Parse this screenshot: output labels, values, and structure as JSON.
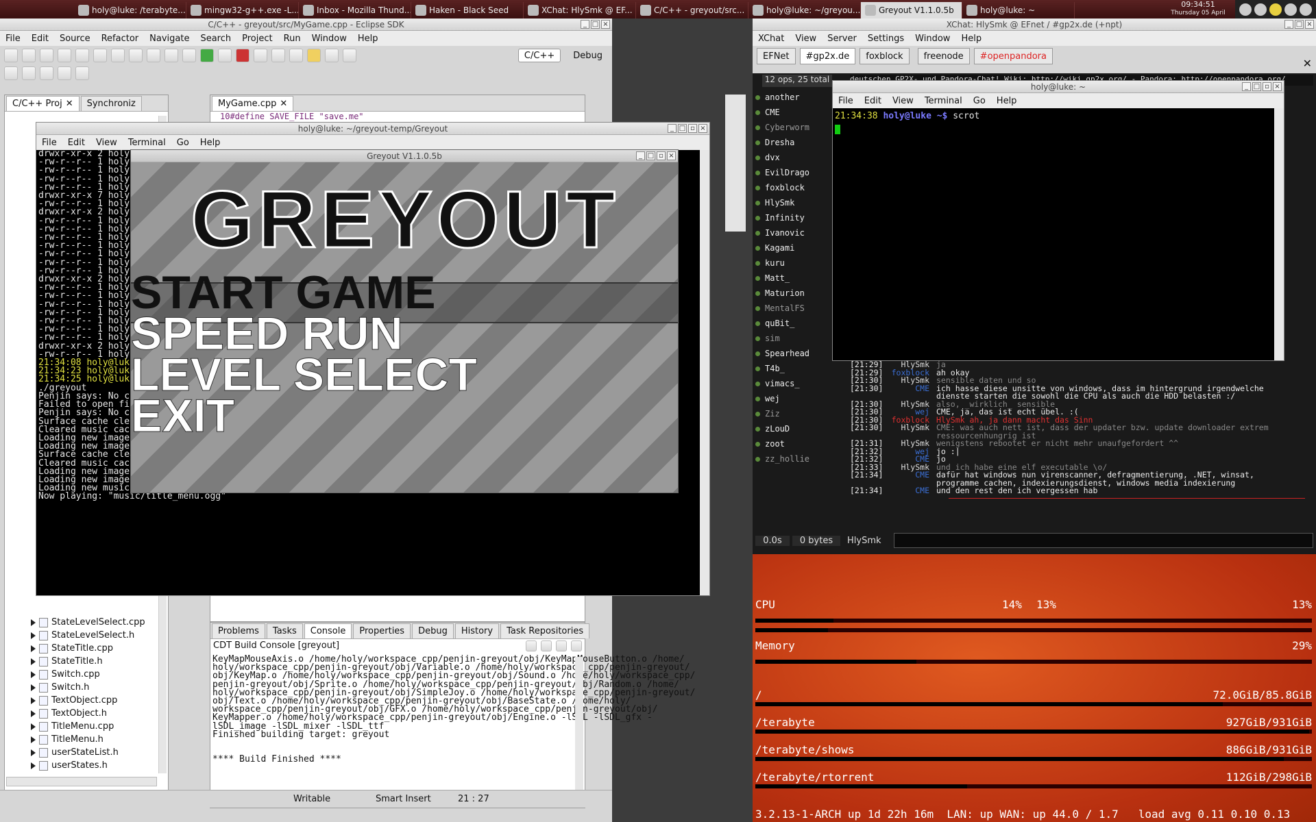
{
  "taskbar": {
    "tasks": [
      {
        "label": "holy@luke: /terabyte...",
        "icon": "terminal-icon"
      },
      {
        "label": "mingw32-g++.exe -L...",
        "icon": "firefox-icon"
      },
      {
        "label": "Inbox - Mozilla Thund...",
        "icon": "thunderbird-icon"
      },
      {
        "label": "Haken - Black Seed",
        "icon": "media-icon"
      },
      {
        "label": "XChat: HlySmk @ EF...",
        "icon": "xchat-icon"
      },
      {
        "label": "C/C++ - greyout/src...",
        "icon": "eclipse-icon"
      },
      {
        "label": "holy@luke: ~/greyou...",
        "icon": "terminal-icon"
      },
      {
        "label": "Greyout V1.1.0.5b",
        "icon": "game-icon"
      },
      {
        "label": "holy@luke: ~",
        "icon": "terminal-icon"
      }
    ],
    "clock_time": "09:34:51",
    "clock_date": "Thursday 05 April"
  },
  "eclipse": {
    "title": "C/C++ - greyout/src/MyGame.cpp - Eclipse SDK",
    "menu": [
      "File",
      "Edit",
      "Source",
      "Refactor",
      "Navigate",
      "Search",
      "Project",
      "Run",
      "Window",
      "Help"
    ],
    "perspectives": [
      "C/C++",
      "Debug"
    ],
    "left_tabs": [
      "C/C++ Proj",
      "Synchroniz"
    ],
    "editor_tab": "MyGame.cpp",
    "editor_line": "10#define SAVE_FILE \"save.me\"",
    "tree": [
      "StateLevelSelect.cpp",
      "StateLevelSelect.h",
      "StateTitle.cpp",
      "StateTitle.h",
      "Switch.cpp",
      "Switch.h",
      "TextObject.cpp",
      "TextObject.h",
      "TitleMenu.cpp",
      "TitleMenu.h",
      "userStateList.h",
      "userStates.h"
    ],
    "bottom_tabs": [
      "Problems",
      "Tasks",
      "Console",
      "Properties",
      "Debug",
      "History",
      "Task Repositories"
    ],
    "console_title": "CDT Build Console [greyout]",
    "console_lines": [
      "KeyMapMouseAxis.o /home/holy/workspace_cpp/penjin-greyout/obj/KeyMapMouseButton.o /home/",
      "holy/workspace_cpp/penjin-greyout/obj/Variable.o /home/holy/workspace_cpp/penjin-greyout/",
      "obj/KeyMap.o /home/holy/workspace_cpp/penjin-greyout/obj/Sound.o /home/holy/workspace_cpp/",
      "penjin-greyout/obj/Sprite.o /home/holy/workspace_cpp/penjin-greyout/obj/Random.o /home/",
      "holy/workspace_cpp/penjin-greyout/obj/SimpleJoy.o /home/holy/workspace_cpp/penjin-greyout/",
      "obj/Text.o /home/holy/workspace_cpp/penjin-greyout/obj/BaseState.o /home/holy/",
      "workspace_cpp/penjin-greyout/obj/GFX.o /home/holy/workspace_cpp/penjin-greyout/obj/",
      "KeyMapper.o /home/holy/workspace_cpp/penjin-greyout/obj/Engine.o -lSDL -lSDL_gfx -",
      "lSDL_image -lSDL_mixer -lSDL_ttf",
      "Finished building target: greyout",
      "",
      "",
      "**** Build Finished ****"
    ],
    "status": [
      "Writable",
      "Smart Insert",
      "21 : 27"
    ]
  },
  "term1": {
    "title": "holy@luke: ~/greyout-temp/Greyout",
    "menu": [
      "File",
      "Edit",
      "View",
      "Terminal",
      "Go",
      "Help"
    ],
    "lines": [
      "drwxr-xr-x 2 holy",
      "-rw-r--r-- 1 holy",
      "-rw-r--r-- 1 holy",
      "-rw-r--r-- 1 holy",
      "-rw-r--r-- 1 holy",
      "drwxr-xr-x 7 holy",
      "-rw-r--r-- 1 holy",
      "drwxr-xr-x 2 holy",
      "-rw-r--r-- 1 holy",
      "-rw-r--r-- 1 holy",
      "-rw-r--r-- 1 holy",
      "-rw-r--r-- 1 holy",
      "-rw-r--r-- 1 holy",
      "-rw-r--r-- 1 holy",
      "-rw-r--r-- 1 holy",
      "drwxr-xr-x 2 holy",
      "-rw-r--r-- 1 holy",
      "-rw-r--r-- 1 holy",
      "-rw-r--r-- 1 holy",
      "-rw-r--r-- 1 holy",
      "-rw-r--r-- 1 holy",
      "-rw-r--r-- 1 holy",
      "-rw-r--r-- 1 holy",
      "drwxr-xr-x 2 holy",
      "-rw-r--r-- 1 holy"
    ],
    "prompts": [
      "21:34:08 holy@luk",
      "21:34:23 holy@luk",
      "21:34:25 holy@luk"
    ],
    "tail": [
      "./greyout",
      "Penjin says: No c",
      "Failed to open fi",
      "Penjin says: No c",
      "Surface cache cle",
      "Cleared music cache - deleted 0 music tracks (0 still playing).",
      "Loading new image to cache \"images/general/Pandora_logo-unofficial.png\"",
      "Loading new image to cache \"images/general/penjinsigok5.png\"",
      "Surface cache cleared - deleted 2 images!",
      "Cleared music cache - deleted 0 music tracks (0 still playing).",
      "Loading new image to cache \"images/menu/title_800_480.png\"",
      "Loading new image to cache \"images/menu/title_marker_800_480.png\"",
      "Loading new music track to cache \"music/title_menu.ogg\"",
      "Now playing: \"music/title_menu.ogg\""
    ]
  },
  "game": {
    "title": "Greyout V1.1.0.5b",
    "logo": "GREYOUT",
    "items": [
      "START GAME",
      "SPEED RUN",
      "LEVEL SELECT",
      "EXIT"
    ]
  },
  "xchat": {
    "title": "XChat: HlySmk @ EFnet / #gp2x.de (+npt)",
    "menu": [
      "XChat",
      "View",
      "Server",
      "Settings",
      "Window",
      "Help"
    ],
    "tabs": [
      "EFNet",
      "#gp2x.de",
      "foxblock",
      "freenode",
      "#openpandora"
    ],
    "topic": "deutschen GP2X- und Pandora-Chat! Wiki: http://wiki.gp2x.org/ - Pandora: http://openpandora.org/",
    "ops": "12 ops, 25 total",
    "nicks": [
      "another",
      "CME",
      "Cyberworm",
      "Dresha",
      "dvx",
      "EvilDrago",
      "foxblock",
      "HlySmk",
      "Infinity",
      "Ivanovic",
      "Kagami",
      "kuru",
      "Matt_",
      "Maturion",
      "MentalFS",
      "quBit_",
      "sim",
      "Spearhead",
      "T4b_",
      "vimacs_",
      "wej",
      "Ziz",
      "zLouD",
      "zoot",
      "zz_hollie"
    ],
    "lines": [
      {
        "t": "[21:29]",
        "n": "HlySmk",
        "m": "ja",
        "c": "#888"
      },
      {
        "t": "[21:29]",
        "n": "foxblock",
        "m": "ah okay",
        "c": "#eee",
        "nc": "#3b6fd6"
      },
      {
        "t": "[21:30]",
        "n": "HlySmk",
        "m": "sensible daten und so",
        "c": "#888"
      },
      {
        "t": "[21:30]",
        "n": "CME",
        "m": "ich hasse diese unsitte von windows, dass im hintergrund irgendwelche",
        "c": "#eee",
        "nc": "#3b6fd6"
      },
      {
        "t": "",
        "n": "",
        "m": "dienste starten die sowohl die CPU als auch die HDD belasten :/",
        "c": "#eee"
      },
      {
        "t": "[21:30]",
        "n": "HlySmk",
        "m": "also, _wirklich_ sensible",
        "c": "#888"
      },
      {
        "t": "[21:30]",
        "n": "wej",
        "m": "CME, ja, das ist echt übel. :(",
        "c": "#eee",
        "nc": "#3b6fd6"
      },
      {
        "t": "[21:30]",
        "n": "foxblock",
        "m": "HlySmk ah, ja dann macht das Sinn",
        "c": "#e03030",
        "nc": "#e03030"
      },
      {
        "t": "[21:30]",
        "n": "HlySmk",
        "m": "CME: was auch nett ist, dass der updater bzw. update downloader extrem",
        "c": "#888"
      },
      {
        "t": "",
        "n": "",
        "m": "ressourcenhungrig ist",
        "c": "#888"
      },
      {
        "t": "[21:31]",
        "n": "HlySmk",
        "m": "wenigstens rebootet er nicht mehr unaufgefordert ^^",
        "c": "#888"
      },
      {
        "t": "[21:32]",
        "n": "wej",
        "m": "jo :|",
        "c": "#eee",
        "nc": "#3b6fd6"
      },
      {
        "t": "[21:32]",
        "n": "CME",
        "m": "jo",
        "c": "#eee",
        "nc": "#3b6fd6"
      },
      {
        "t": "[21:33]",
        "n": "HlySmk",
        "m": "und ich habe eine elf executable \\o/",
        "c": "#888"
      },
      {
        "t": "[21:34]",
        "n": "CME",
        "m": "dafür hat windows nun virenscanner, defragmentierung, .NET, winsat,",
        "c": "#eee",
        "nc": "#3b6fd6"
      },
      {
        "t": "",
        "n": "",
        "m": "programme cachen, indexierungsdienst, windows media indexierung",
        "c": "#eee"
      },
      {
        "t": "[21:34]",
        "n": "CME",
        "m": "und den rest den ich vergessen hab",
        "c": "#eee",
        "nc": "#3b6fd6"
      }
    ],
    "lag": "0.0s",
    "bytes": "0 bytes",
    "input_nick": "HlySmk"
  },
  "term2": {
    "title": "holy@luke: ~",
    "menu": [
      "File",
      "Edit",
      "View",
      "Terminal",
      "Go",
      "Help"
    ],
    "prompt_time": "21:34:38",
    "prompt_user": "holy@luke",
    "prompt_path": "~$",
    "command": "scrot"
  },
  "conky": {
    "cpu_label": "CPU",
    "cpu1": "14%",
    "cpu2": "13%",
    "cpu_total": "13%",
    "cpu_fill1": 0.14,
    "cpu_fill2": 0.13,
    "mem_label": "Memory",
    "mem_value": "29%",
    "mem_fill": 0.29,
    "disks": [
      {
        "label": "/",
        "value": "72.0GiB/85.8GiB",
        "fill": 0.84
      },
      {
        "label": "/terabyte",
        "value": "927GiB/931GiB",
        "fill": 0.995
      },
      {
        "label": "/terabyte/shows",
        "value": "886GiB/931GiB",
        "fill": 0.95
      },
      {
        "label": "/terabyte/rtorrent",
        "value": "112GiB/298GiB",
        "fill": 0.38
      }
    ],
    "footer": "3.2.13-1-ARCH up 1d 22h 16m  LAN: up WAN: up 44.0 / 1.7   load avg 0.11 0.10 0.13"
  },
  "colors": {
    "conky_bg": "#d0481a",
    "xchat_bg": "#1a1a1a"
  }
}
